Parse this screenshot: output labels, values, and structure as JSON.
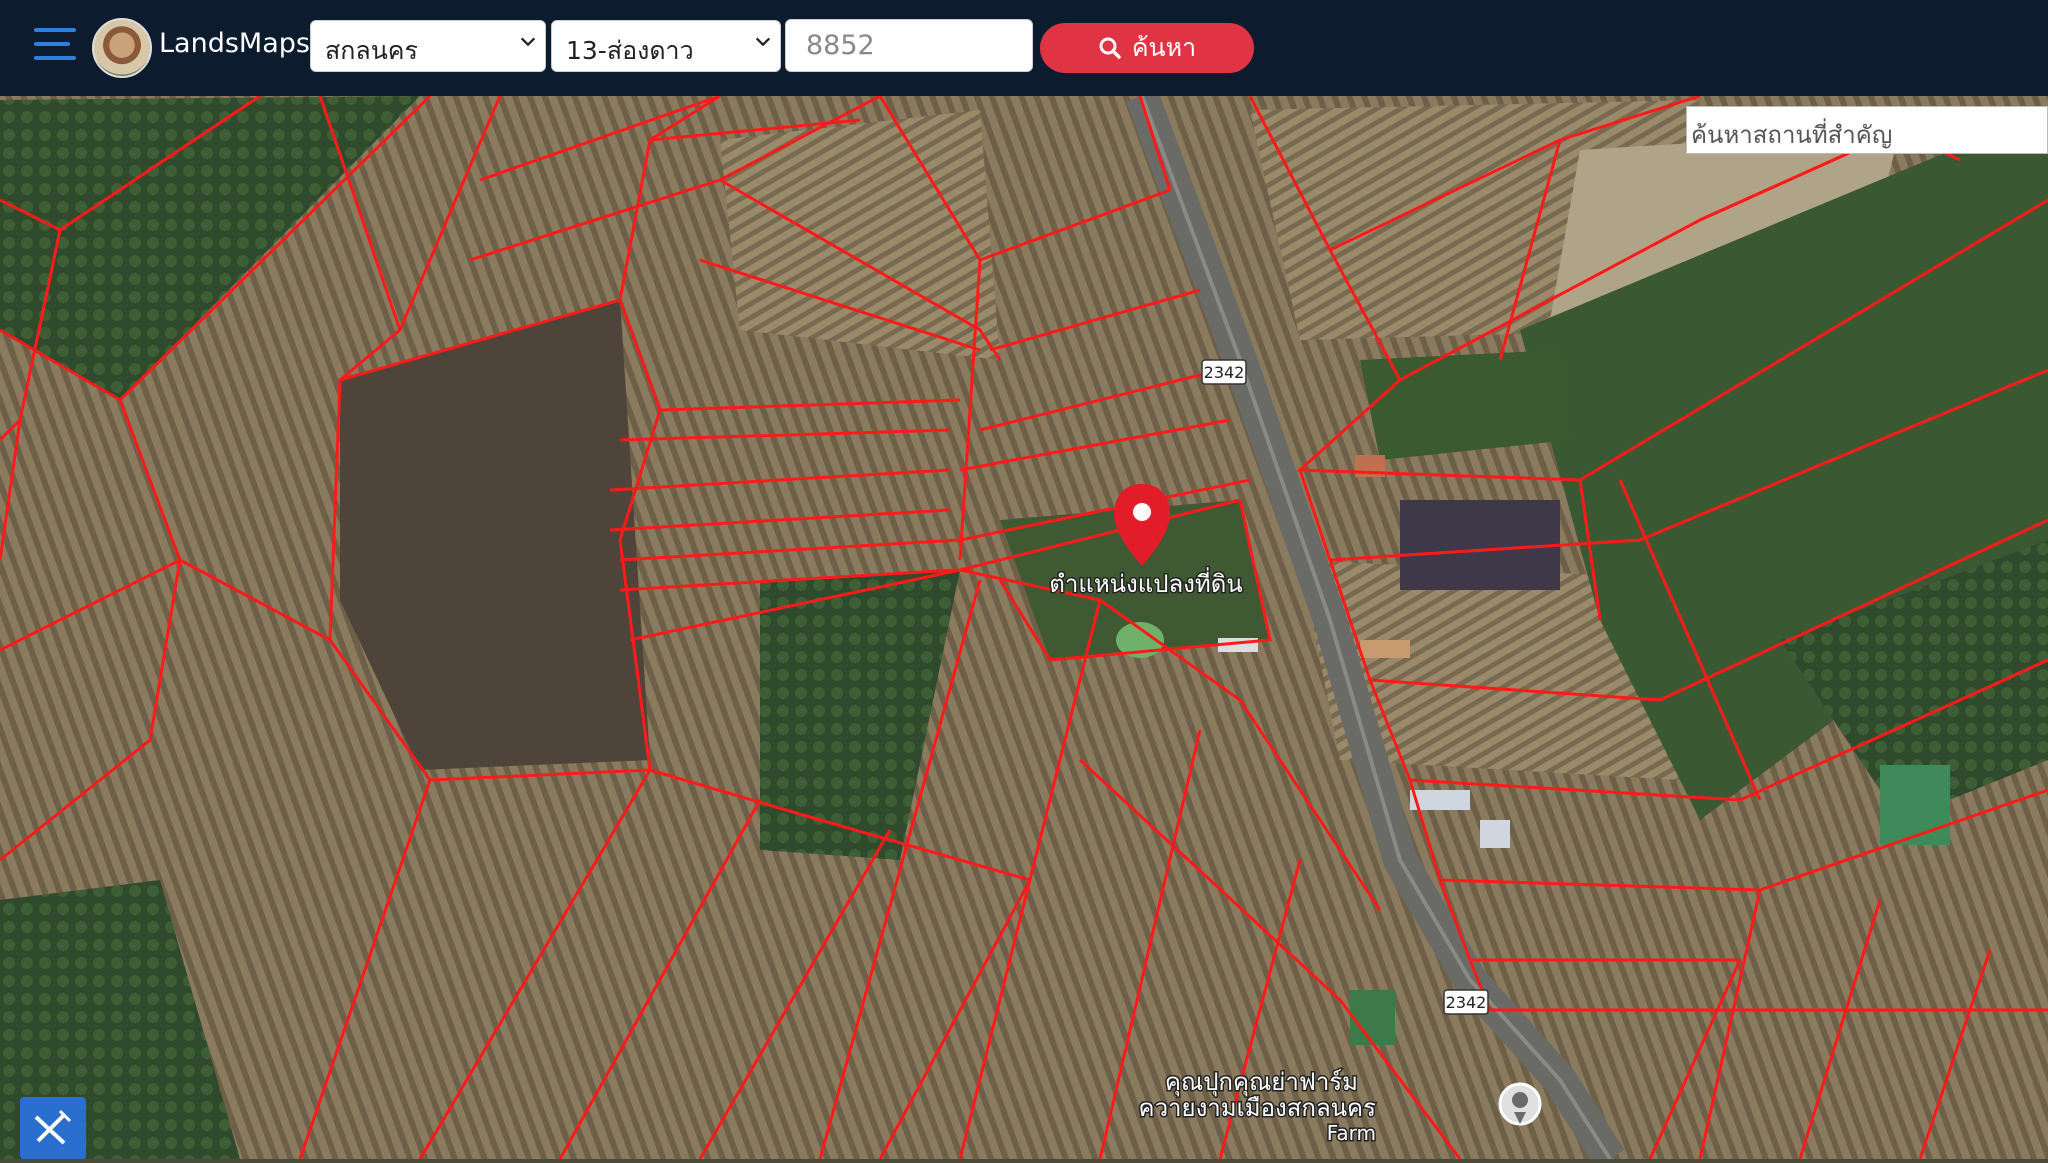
{
  "header": {
    "brand": "LandsMaps",
    "province": "สกลนคร",
    "district": "13-ส่องดาว",
    "parcel_number": "8852",
    "search_label": "ค้นหา"
  },
  "map": {
    "place_search_placeholder": "ค้นหาสถานที่สำคัญ",
    "marker_label": "ตำแหน่งแปลงที่ดิน",
    "road_number_north": "2342",
    "road_number_south": "2342",
    "poi_line1": "คุณปุกคุณย่าฟาร์ม",
    "poi_line2": "ควายงามเมืองสกลนคร",
    "poi_line3": "Farm"
  },
  "colors": {
    "header_bg": "#0d1b2e",
    "accent_blue": "#2f7fe0",
    "search_red": "#e03444",
    "parcel_line": "#ff1a1a"
  },
  "icons": {
    "menu": "hamburger-icon",
    "search": "search-icon",
    "marker": "map-pin-icon",
    "tool": "measure-tools-icon"
  }
}
